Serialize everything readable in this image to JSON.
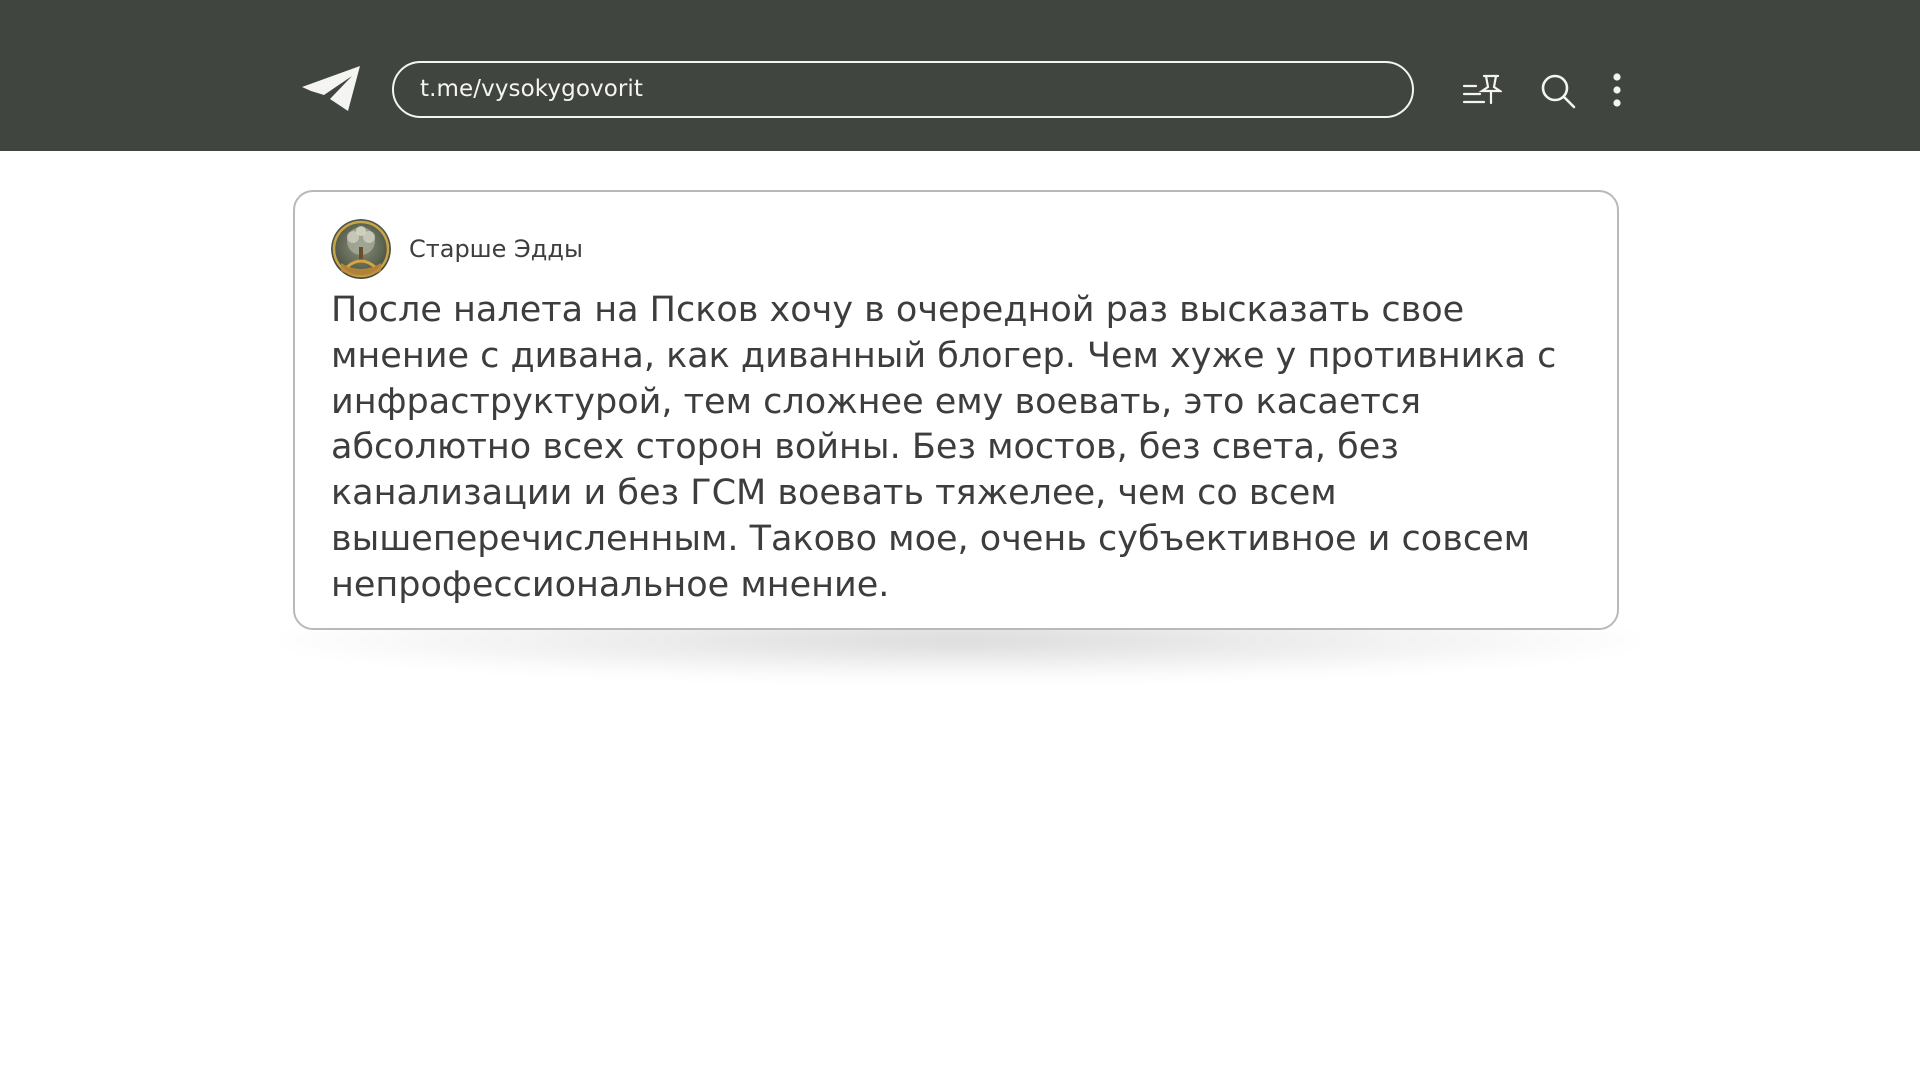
{
  "header": {
    "url": "t.me/vysokygovorit",
    "icons": {
      "logo": "telegram-logo-icon",
      "pinned": "pinned-list-icon",
      "search": "search-icon",
      "menu": "more-vertical-icon"
    },
    "colors": {
      "background": "#40453f",
      "foreground": "#f4f4f2"
    }
  },
  "post": {
    "author": "Старше Эдды",
    "text": "После налета на Псков хочу в очередной раз высказать свое\nмнение с дивана, как диванный блогер. Чем хуже у противника с\nинфраструктурой, тем сложнее ему воевать, это касается\nабсолютно всех сторон войны. Без мостов, без света, без\nканализации и без ГСМ воевать тяжелее, чем со всем\nвышеперечисленным. Таково мое, очень субъективное и совсем\nнепрофессиональное мнение.",
    "colors": {
      "text": "#3d3d3d",
      "border": "#b9b9b9"
    }
  }
}
